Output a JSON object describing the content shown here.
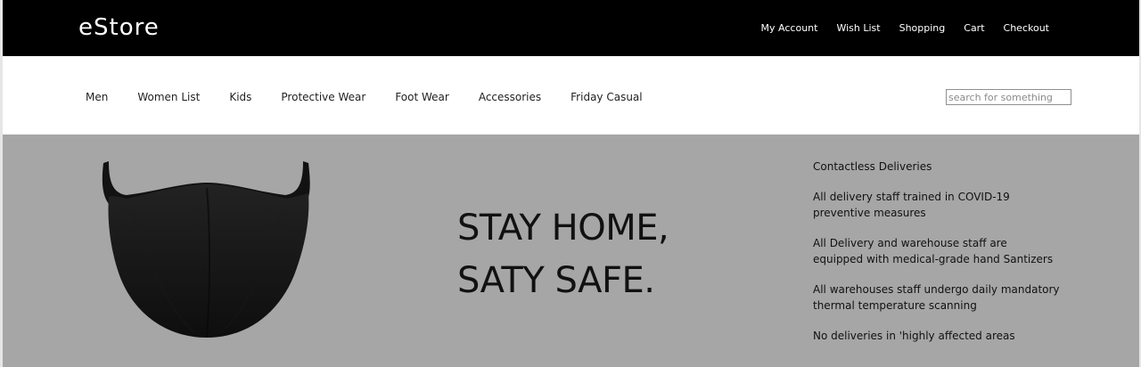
{
  "header": {
    "brand": "eStore",
    "account_nav": [
      "My Account",
      "Wish List",
      "Shopping",
      "Cart",
      "Checkout"
    ]
  },
  "categories": [
    "Men",
    "Women List",
    "Kids",
    "Protective Wear",
    "Foot Wear",
    "Accessories",
    "Friday Casual"
  ],
  "search": {
    "placeholder": "search for something",
    "value": ""
  },
  "hero": {
    "image": "black-face-mask",
    "heading_line1": "STAY HOME,",
    "heading_line2": "SATY SAFE."
  },
  "delivery": {
    "title": "Contactless Deliveries",
    "items": [
      [
        "All delivery staff trained in COVID-19",
        "preventive measures"
      ],
      [
        "All Delivery and warehouse staff are",
        "equipped with medical-grade hand Santizers"
      ],
      [
        "All warehouses staff undergo daily mandatory",
        "thermal temperature scanning"
      ],
      [
        "No deliveries in 'highly affected areas"
      ]
    ]
  },
  "colors": {
    "header_bg": "#000000",
    "header_text": "#ffffff",
    "hero_bg": "#a6a6a6",
    "mask": "#141414"
  }
}
